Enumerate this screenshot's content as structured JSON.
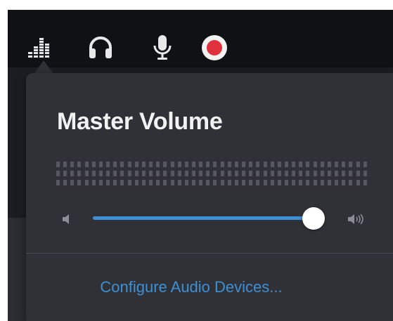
{
  "toolbar": {
    "icons": [
      {
        "name": "levels-icon",
        "tooltip": ""
      },
      {
        "name": "headphones-icon",
        "tooltip": ""
      },
      {
        "name": "microphone-icon",
        "tooltip": ""
      },
      {
        "name": "record-icon",
        "tooltip": ""
      }
    ],
    "record_color": "#e0303c"
  },
  "popover": {
    "title": "Master Volume",
    "meter_segments": 44,
    "volume_level": 0.95,
    "accent_color": "#3d8fd6",
    "configure_label": "Configure Audio Devices..."
  }
}
